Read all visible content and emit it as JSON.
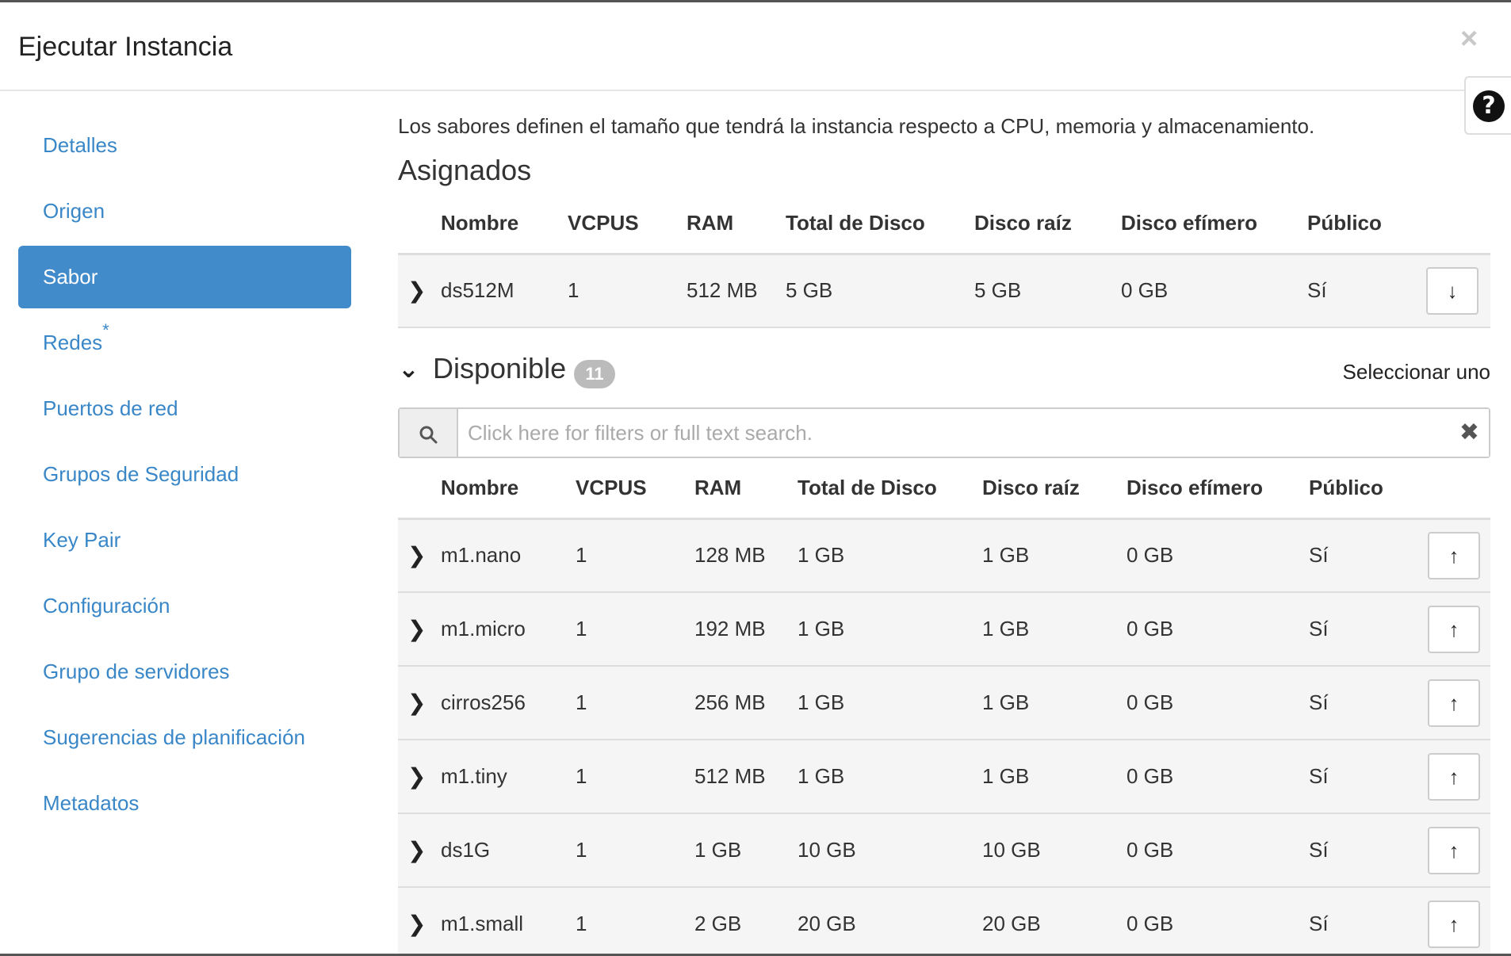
{
  "modal": {
    "title": "Ejecutar Instancia",
    "close_icon": "×",
    "help_icon": "?"
  },
  "sidebar": {
    "items": [
      {
        "label": "Detalles"
      },
      {
        "label": "Origen"
      },
      {
        "label": "Sabor",
        "active": true
      },
      {
        "label": "Redes",
        "required": "*"
      },
      {
        "label": "Puertos de red"
      },
      {
        "label": "Grupos de Seguridad"
      },
      {
        "label": "Key Pair"
      },
      {
        "label": "Configuración"
      },
      {
        "label": "Grupo de servidores"
      },
      {
        "label": "Sugerencias de planificación"
      },
      {
        "label": "Metadatos"
      }
    ]
  },
  "main": {
    "intro": "Los sabores definen el tamaño que tendrá la instancia respecto a CPU, memoria y almacenamiento.",
    "allocated_title": "Asignados",
    "columns": [
      "Nombre",
      "VCPUS",
      "RAM",
      "Total de Disco",
      "Disco raíz",
      "Disco efímero",
      "Público"
    ],
    "allocated_rows": [
      {
        "name": "ds512M",
        "vcpus": "1",
        "ram": "512 MB",
        "total_disk": "5 GB",
        "root_disk": "5 GB",
        "ephemeral": "0 GB",
        "public": "Sí"
      }
    ],
    "available_title": "Disponible",
    "available_count": "11",
    "select_one": "Seleccionar uno",
    "search_placeholder": "Click here for filters or full text search.",
    "available_rows": [
      {
        "name": "m1.nano",
        "vcpus": "1",
        "ram": "128 MB",
        "total_disk": "1 GB",
        "root_disk": "1 GB",
        "ephemeral": "0 GB",
        "public": "Sí"
      },
      {
        "name": "m1.micro",
        "vcpus": "1",
        "ram": "192 MB",
        "total_disk": "1 GB",
        "root_disk": "1 GB",
        "ephemeral": "0 GB",
        "public": "Sí"
      },
      {
        "name": "cirros256",
        "vcpus": "1",
        "ram": "256 MB",
        "total_disk": "1 GB",
        "root_disk": "1 GB",
        "ephemeral": "0 GB",
        "public": "Sí"
      },
      {
        "name": "m1.tiny",
        "vcpus": "1",
        "ram": "512 MB",
        "total_disk": "1 GB",
        "root_disk": "1 GB",
        "ephemeral": "0 GB",
        "public": "Sí"
      },
      {
        "name": "ds1G",
        "vcpus": "1",
        "ram": "1 GB",
        "total_disk": "10 GB",
        "root_disk": "10 GB",
        "ephemeral": "0 GB",
        "public": "Sí"
      },
      {
        "name": "m1.small",
        "vcpus": "1",
        "ram": "2 GB",
        "total_disk": "20 GB",
        "root_disk": "20 GB",
        "ephemeral": "0 GB",
        "public": "Sí"
      }
    ]
  }
}
